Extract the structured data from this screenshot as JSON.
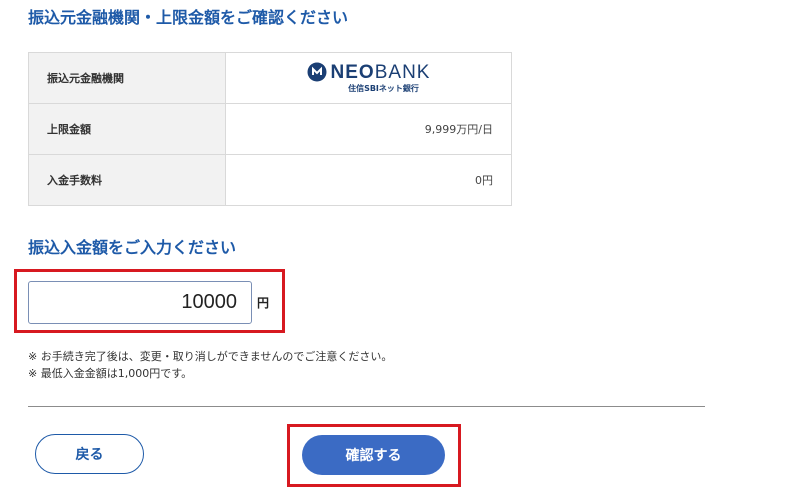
{
  "section1": {
    "title": "振込元金融機関・上限金額をご確認ください"
  },
  "table": {
    "rows": [
      {
        "label": "振込元金融機関",
        "value": ""
      },
      {
        "label": "上限金額",
        "value": "9,999万円/日"
      },
      {
        "label": "入金手数料",
        "value": "0円"
      }
    ]
  },
  "bank_logo": {
    "icon": "neobank-logo-icon",
    "name_bold": "NEO",
    "name_light": "BANK",
    "sub": "住信SBIネット銀行",
    "color": "#1b3f74"
  },
  "section2": {
    "title": "振込入金額をご入力ください"
  },
  "amount": {
    "value": "10000",
    "unit": "円"
  },
  "notes": [
    "※ お手続き完了後は、変更・取り消しができませんのでご注意ください。",
    "※ 最低入金金額は1,000円です。"
  ],
  "buttons": {
    "back": "戻る",
    "confirm": "確認する"
  },
  "colors": {
    "accent": "#1e5aa8",
    "confirm_bg": "#3b6bc4",
    "highlight": "#d71920"
  }
}
